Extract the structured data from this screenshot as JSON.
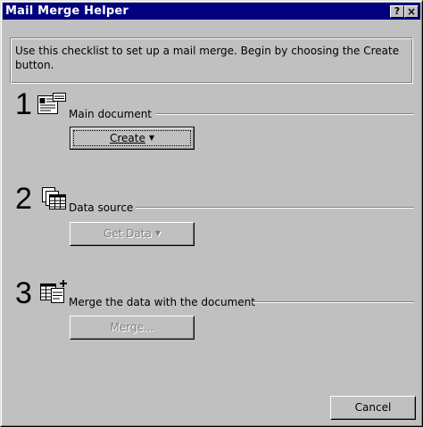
{
  "window": {
    "title": "Mail Merge Helper",
    "title_buttons": {
      "help": "?",
      "close": "×"
    }
  },
  "info": {
    "text": "Use this checklist to set up a mail merge. Begin by choosing the Create button."
  },
  "steps": [
    {
      "number": "1",
      "label": "Main document",
      "icon": "main-document-icon",
      "button": "Create",
      "button_has_dropdown": true,
      "button_enabled": true
    },
    {
      "number": "2",
      "label": "Data source",
      "icon": "data-source-icon",
      "button": "Get Data",
      "button_has_dropdown": true,
      "button_enabled": false
    },
    {
      "number": "3",
      "label": "Merge the data with the document",
      "icon": "merge-icon",
      "button": "Merge...",
      "button_has_dropdown": false,
      "button_enabled": false
    }
  ],
  "footer": {
    "cancel_label": "Cancel"
  },
  "colors": {
    "titlebar": "#000080",
    "face": "#c0c0c0",
    "shadow": "#808080",
    "highlight": "#ffffff"
  }
}
